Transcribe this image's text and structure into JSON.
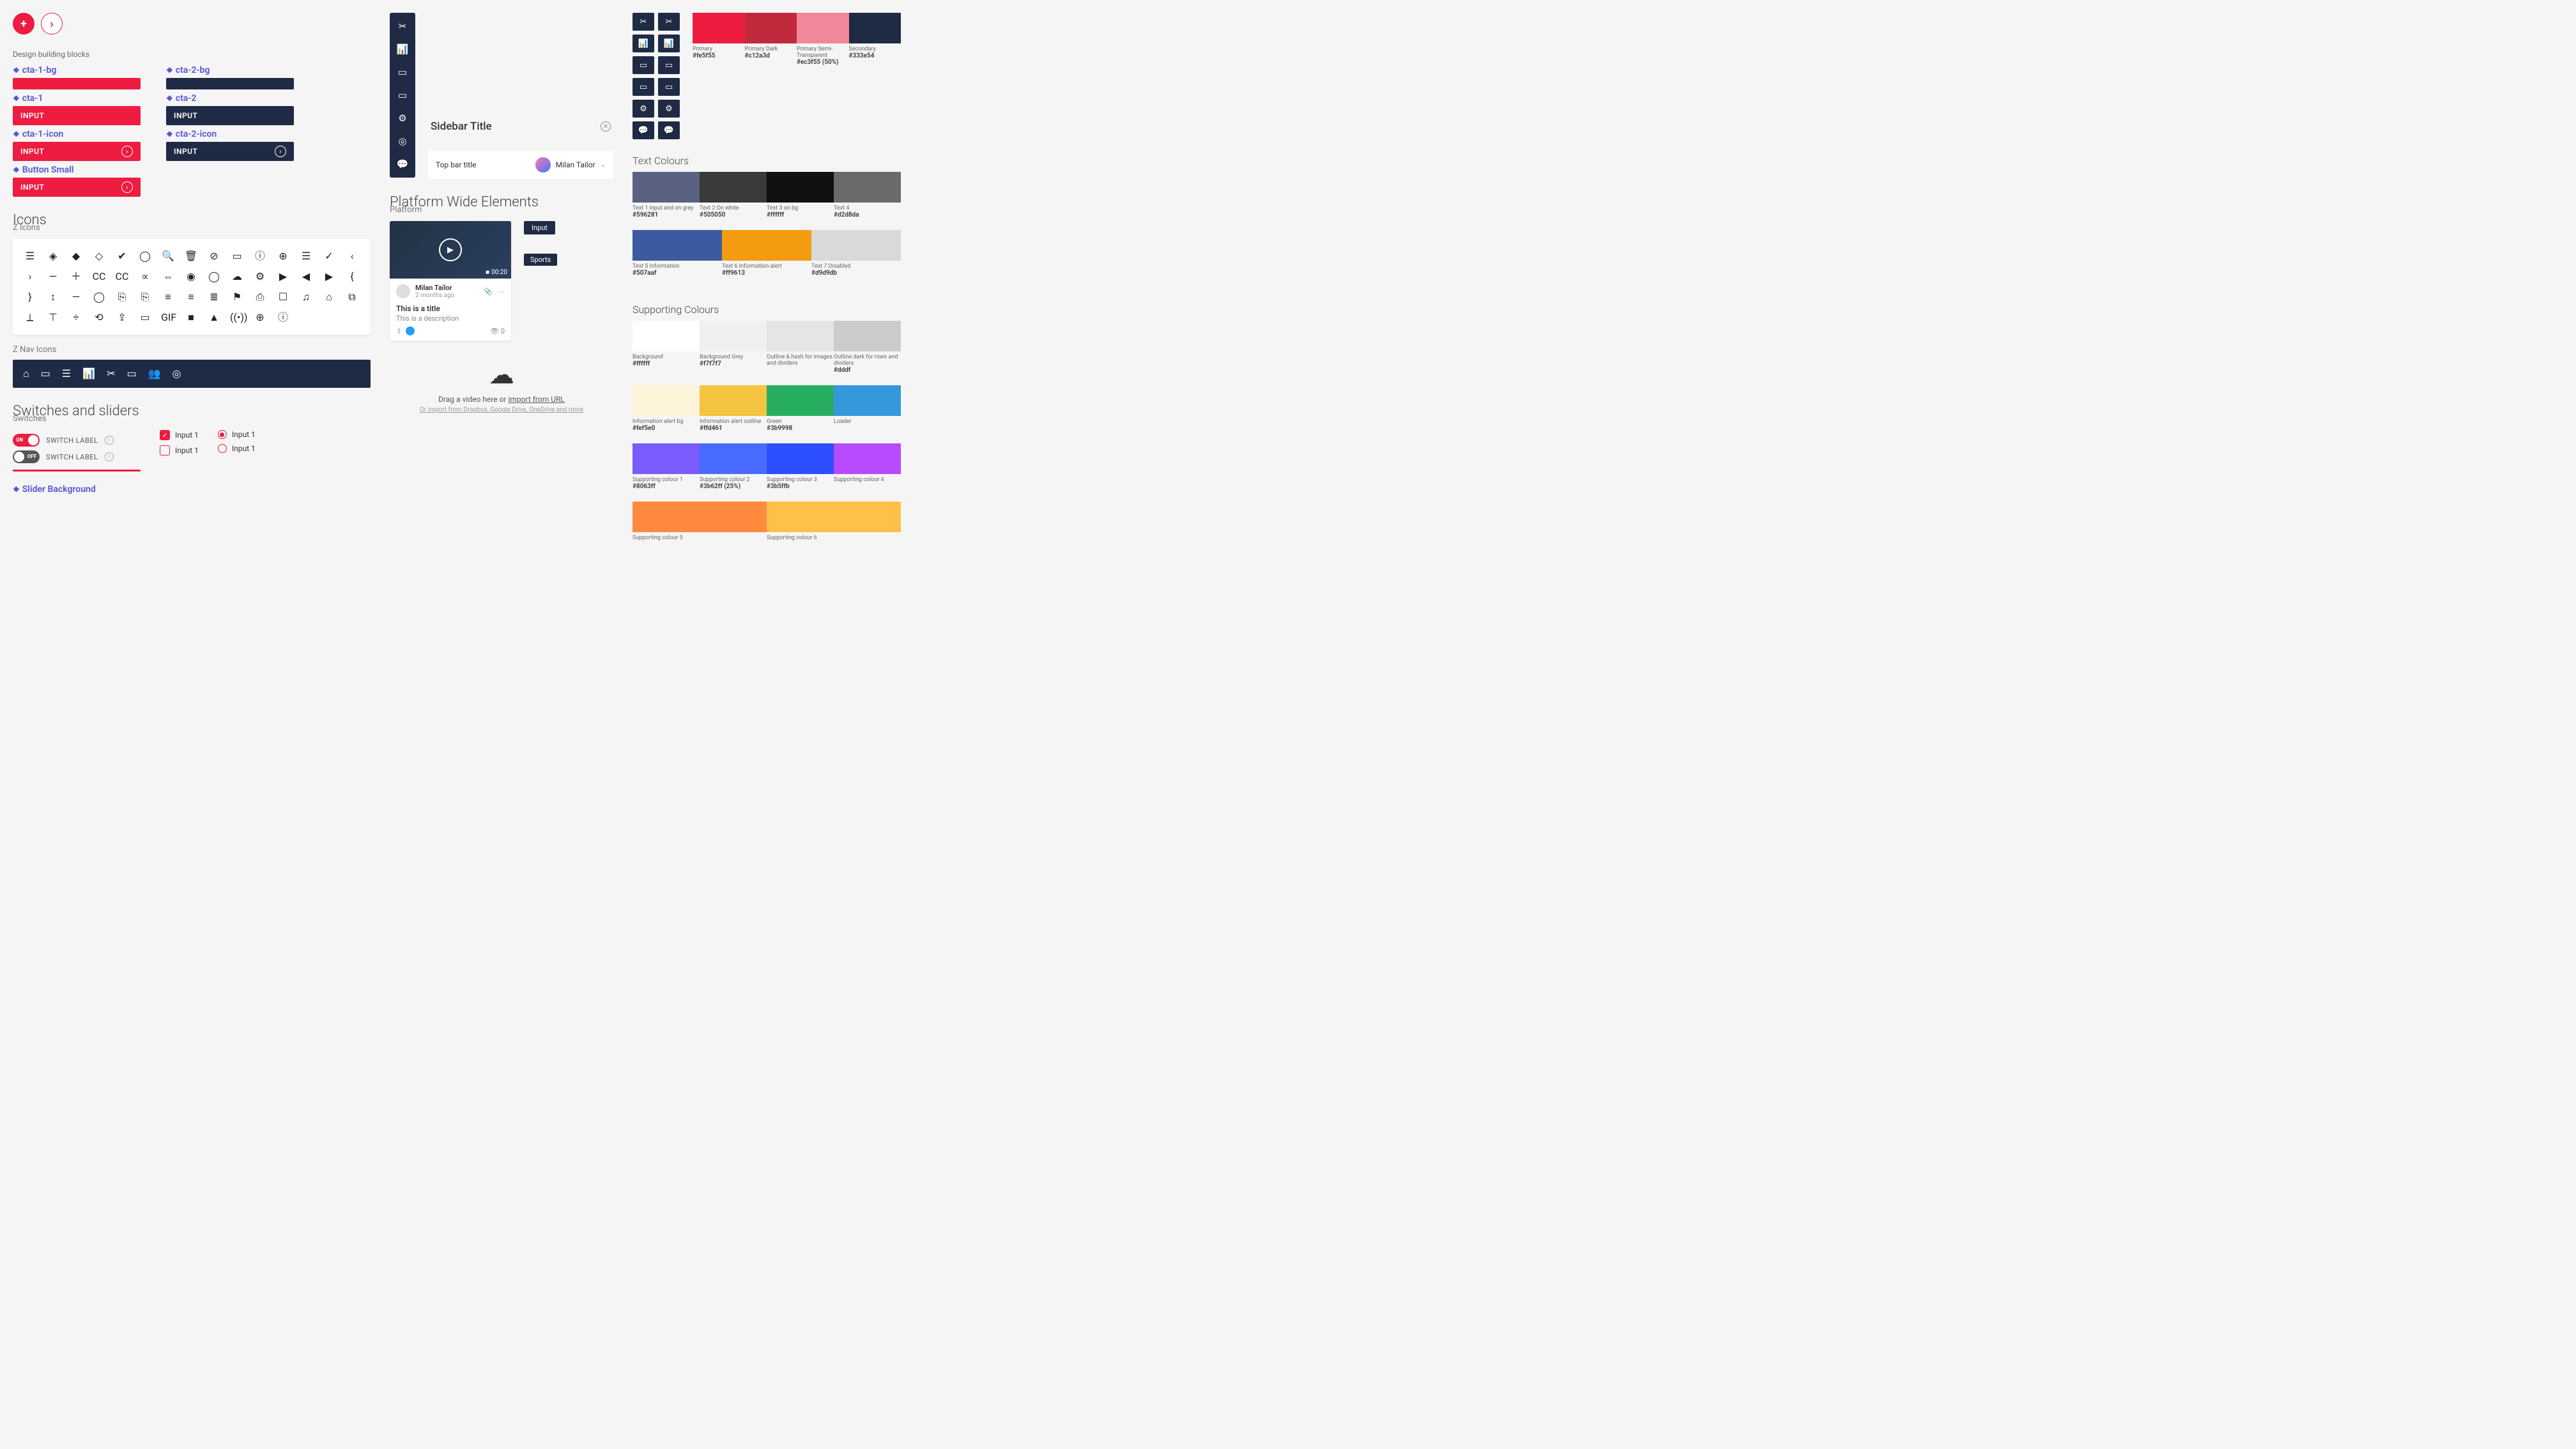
{
  "top": {
    "plus": "+",
    "chevron": "›"
  },
  "blocks": {
    "heading": "Design building blocks",
    "left": {
      "bg_label": "cta-1-bg",
      "cta_label": "cta-1",
      "cta_text": "INPUT",
      "icon_label": "cta-1-icon",
      "icon_text": "INPUT",
      "small_label": "Button Small",
      "small_text": "INPUT"
    },
    "right": {
      "bg_label": "cta-2-bg",
      "cta_label": "cta-2",
      "cta_text": "INPUT",
      "icon_label": "cta-2-icon",
      "icon_text": "INPUT"
    }
  },
  "icons": {
    "title": "Icons",
    "sub": "Z Icons",
    "nav_title": "Z Nav Icons",
    "glyphs": [
      "☰",
      "◈",
      "◆",
      "◇",
      "✔",
      "◯",
      "🔍",
      "🗑",
      "⊘",
      "▭",
      "ⓘ",
      "⊕",
      "☰",
      "✓",
      "‹",
      "›",
      "—",
      "＋",
      "CC",
      "CC",
      "∝",
      "⇔",
      "◉",
      "◯",
      "☁",
      "⚙",
      "▶",
      "◀",
      "▶",
      "{",
      "}",
      "↕",
      "—",
      "◯",
      "⎘",
      "⎘",
      "≡",
      "≡",
      "≣",
      "⚑",
      "⎙",
      "☐",
      "♫",
      "⌂",
      "⧉",
      "⟂",
      "⊤",
      "÷",
      "⟲",
      "⇪",
      "▭",
      "GIF",
      "■",
      "▲",
      "((•))",
      "⊕",
      "ⓘ"
    ],
    "nav_glyphs": [
      "⌂",
      "▭",
      "☰",
      "📊",
      "✂",
      "▭",
      "👥",
      "◎"
    ]
  },
  "switches": {
    "title": "Switches and sliders",
    "sub": "Switches",
    "on_text": "ON",
    "off_text": "OFF",
    "label": "SWITCH LABEL",
    "option_text": "Input 1",
    "slider_label": "Slider Background"
  },
  "mid": {
    "vnav": [
      "✂",
      "📊",
      "▭",
      "▭",
      "⚙",
      "◎",
      "💬"
    ],
    "mini_grid": [
      "✂",
      "✂",
      "📊",
      "📊",
      "▭",
      "▭",
      "▭",
      "▭",
      "⚙",
      "⚙",
      "💬",
      "💬"
    ],
    "sidebar_title": "Sidebar Title",
    "topbar_title": "Top bar title",
    "username": "Milan Tailor",
    "platform_title": "Platform Wide Elements",
    "platform_sub": "Platform",
    "card": {
      "duration": "00:20",
      "user": "Milan Tailor",
      "time": "2 months ago",
      "title": "This is a title",
      "desc": "This is a description",
      "count": "0"
    },
    "input_chip": "Input",
    "tag_chip": "Sports",
    "upload": {
      "text_a": "Drag a video here or ",
      "text_link": "import from URL",
      "sub_prefix": "Or import from ",
      "sub_rest": "Dropbox, Google Drive, OneDrive and more"
    }
  },
  "colours": {
    "primary_header": "Primary",
    "primary": [
      {
        "name": "Primary",
        "hex": "#fe5f55",
        "c": "#ed1c40"
      },
      {
        "name": "Primary Dark",
        "hex": "#c12a3d",
        "c": "#c12a3d"
      },
      {
        "name": "Primary Semi-Transparent",
        "hex": "#ec3f55 (50%)",
        "c": "rgba(237,28,64,0.5)"
      },
      {
        "name": "Secondary",
        "hex": "#333e54",
        "c": "#1f2a44"
      }
    ],
    "text_header": "Text Colours",
    "text_row1": [
      {
        "name": "Text 1 input and on grey",
        "hex": "#596281",
        "c": "#596281"
      },
      {
        "name": "Text 2 On white",
        "hex": "#505050",
        "c": "#3a3a3a"
      },
      {
        "name": "Text 3 on bg",
        "hex": "#ffffff",
        "c": "#111"
      },
      {
        "name": "Text 4",
        "hex": "#d2d8da",
        "c": "#6a6a6a"
      }
    ],
    "text_row2": [
      {
        "name": "Text 5 Information",
        "hex": "#507aaf",
        "c": "#3b5aa0"
      },
      {
        "name": "Text 6 Information alert",
        "hex": "#ff9613",
        "c": "#f39c12"
      },
      {
        "name": "Text 7 Disabled",
        "hex": "#d9d9db",
        "c": "#d9d9db"
      }
    ],
    "support_header": "Supporting Colours",
    "support_row1": [
      {
        "name": "Background",
        "hex": "#ffffff",
        "c": "#ffffff"
      },
      {
        "name": "Background Grey",
        "hex": "#f7f7f7",
        "c": "#f0f0f0"
      },
      {
        "name": "Outline & hash for images and dividers",
        "hex": "",
        "c": "#e5e5e5"
      },
      {
        "name": "Outline dark for rows and dividers",
        "hex": "#dddf",
        "c": "#ccc"
      }
    ],
    "support_row2": [
      {
        "name": "Information alert bg",
        "hex": "#fef5e0",
        "c": "#fdf3d8"
      },
      {
        "name": "Information alert outline",
        "hex": "#ffd461",
        "c": "#f5c542"
      },
      {
        "name": "Green",
        "hex": "#3b9998",
        "c": "#27ae60"
      },
      {
        "name": "Loader",
        "hex": "",
        "c": "#3498db"
      }
    ],
    "support_row3": [
      {
        "name": "Supporting colour 1",
        "hex": "#8063ff",
        "c": "#7b5cff"
      },
      {
        "name": "Supporting colour 2",
        "hex": "#3b62ff (25%)",
        "c": "#4a6bff"
      },
      {
        "name": "Supporting colour 3",
        "hex": "#3b5ffb",
        "c": "#2d4fff"
      },
      {
        "name": "Supporting colour 4",
        "hex": "",
        "c": "#b84aff"
      }
    ],
    "support_row4": [
      {
        "name": "Supporting colour 5",
        "hex": "",
        "c": "#ff8a3d"
      },
      {
        "name": "Supporting colour 6",
        "hex": "",
        "c": "#ffc04a"
      }
    ]
  }
}
